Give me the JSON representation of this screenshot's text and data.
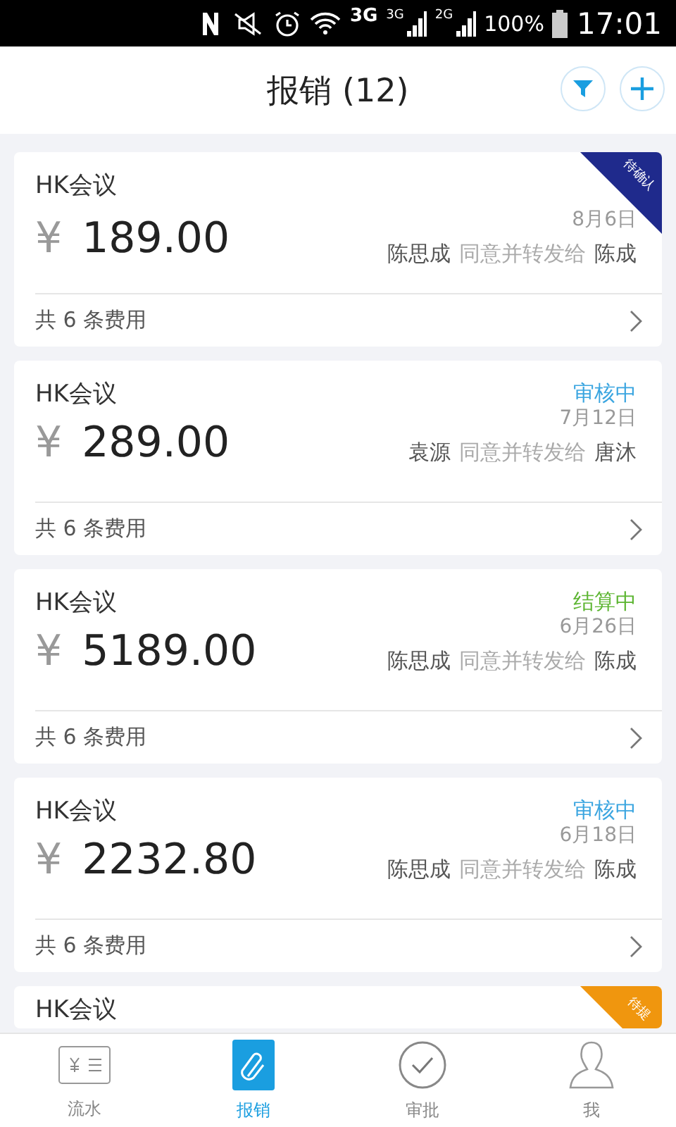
{
  "status_bar": {
    "network": "3G",
    "signals": [
      "3G",
      "2G"
    ],
    "battery": "100%",
    "time": "17:01"
  },
  "header": {
    "title": "报销 (12)"
  },
  "cards": [
    {
      "title": "HK会议",
      "amount": "189.00",
      "currency": "¥",
      "date": "8月6日",
      "from": "陈思成",
      "action": "同意并转发给",
      "to": "陈成",
      "footer": "共 6 条费用",
      "status": {
        "kind": "ribbon",
        "text": "待确认",
        "color": "#1f2a8c"
      }
    },
    {
      "title": "HK会议",
      "amount": "289.00",
      "currency": "¥",
      "date": "7月12日",
      "from": "袁源",
      "action": "同意并转发给",
      "to": "唐沐",
      "footer": "共 6 条费用",
      "status": {
        "kind": "label",
        "text": "审核中",
        "color": "#3aa5e0"
      }
    },
    {
      "title": "HK会议",
      "amount": "5189.00",
      "currency": "¥",
      "date": "6月26日",
      "from": "陈思成",
      "action": "同意并转发给",
      "to": "陈成",
      "footer": "共 6 条费用",
      "status": {
        "kind": "label",
        "text": "结算中",
        "color": "#5cb531"
      }
    },
    {
      "title": "HK会议",
      "amount": "2232.80",
      "currency": "¥",
      "date": "6月18日",
      "from": "陈思成",
      "action": "同意并转发给",
      "to": "陈成",
      "footer": "共 6 条费用",
      "status": {
        "kind": "label",
        "text": "审核中",
        "color": "#3aa5e0"
      }
    },
    {
      "title": "HK会议",
      "status": {
        "kind": "ribbon",
        "text": "待提",
        "color": "#f0960e"
      }
    }
  ],
  "tabs": [
    {
      "label": "流水",
      "selected": false
    },
    {
      "label": "报销",
      "selected": true
    },
    {
      "label": "审批",
      "selected": false
    },
    {
      "label": "我",
      "selected": false
    }
  ]
}
